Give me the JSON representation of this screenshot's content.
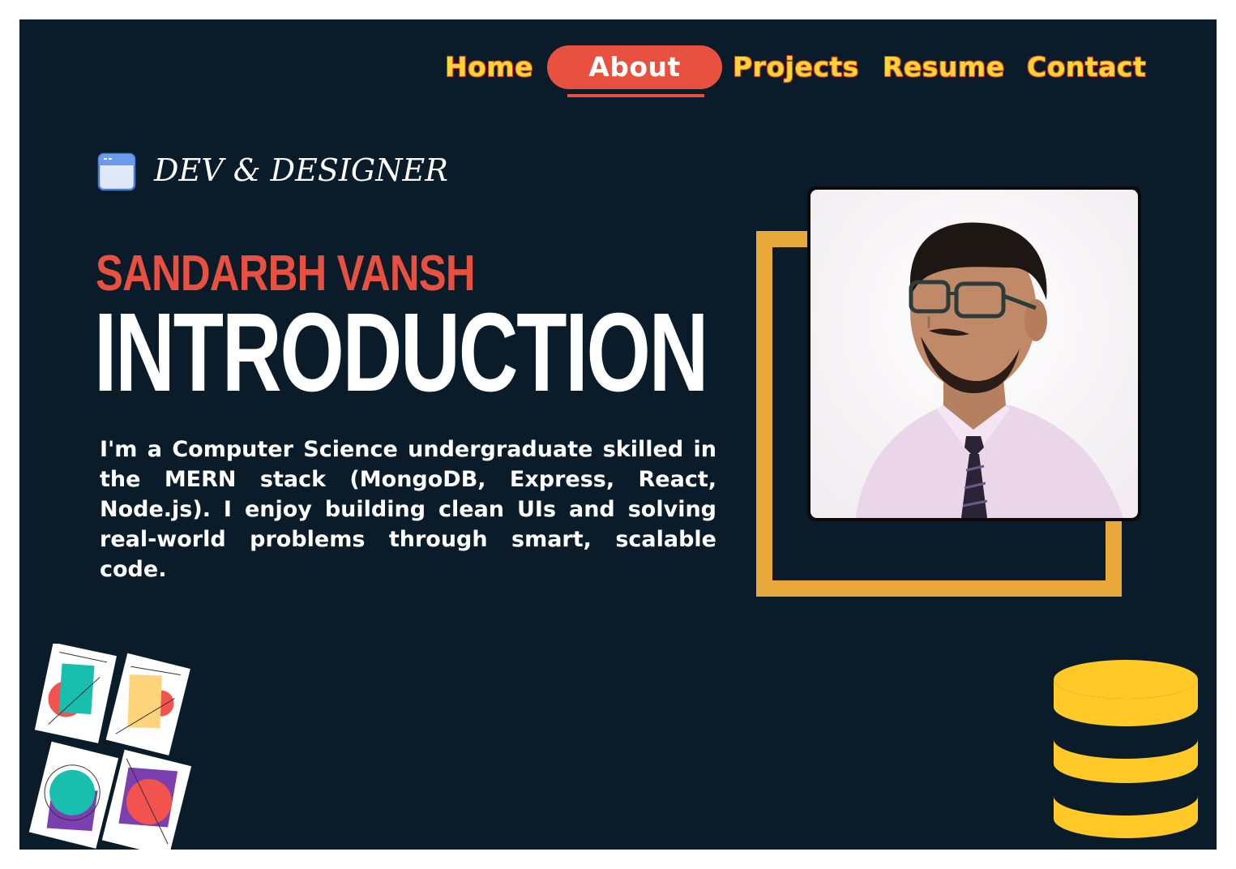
{
  "nav": {
    "items": [
      {
        "label": "Home",
        "active": false
      },
      {
        "label": "About",
        "active": true
      },
      {
        "label": "Projects",
        "active": false
      },
      {
        "label": "Resume",
        "active": false
      },
      {
        "label": "Contact",
        "active": false
      }
    ]
  },
  "hero": {
    "tag_icon": "browser-window-icon",
    "tagline": "DEV & DESIGNER",
    "name": "SANDARBH VANSH",
    "heading": "INTRODUCTION",
    "bio": "I'm a Computer Science undergraduate skilled in the MERN stack (MongoDB, Express, React, Node.js). I enjoy building clean UIs and solving real-world problems through smart, scalable code."
  },
  "decor": {
    "left_illustration": "abstract-art-cards-illustration",
    "right_illustration": "database-icon"
  },
  "colors": {
    "background": "#0a1c2a",
    "accent": "#e8503f",
    "nav_text": "#ffd633",
    "frame": "#e8a93a",
    "database": "#ffc928"
  }
}
